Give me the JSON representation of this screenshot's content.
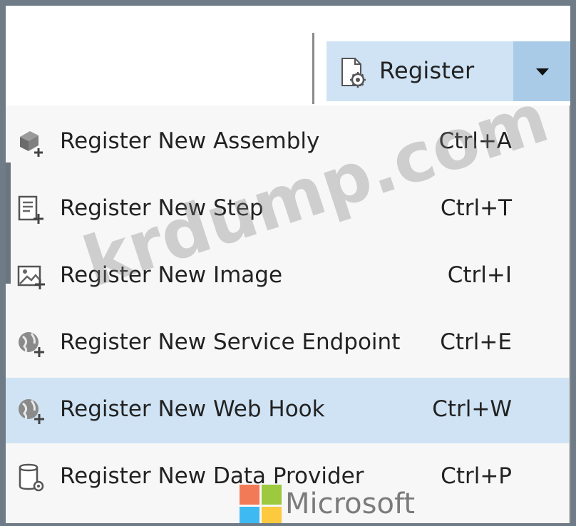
{
  "toolbar": {
    "register_label": "Register",
    "register_icon": "register-plugin-icon",
    "dropdown_icon": "chevron-down-icon"
  },
  "menu": {
    "items": [
      {
        "label": "Register New Assembly",
        "shortcut": "Ctrl+A",
        "icon": "assembly-add-icon",
        "highlighted": false
      },
      {
        "label": "Register New Step",
        "shortcut": "Ctrl+T",
        "icon": "step-add-icon",
        "highlighted": false
      },
      {
        "label": "Register New Image",
        "shortcut": "Ctrl+I",
        "icon": "image-add-icon",
        "highlighted": false
      },
      {
        "label": "Register New Service Endpoint",
        "shortcut": "Ctrl+E",
        "icon": "globe-add-icon",
        "highlighted": false
      },
      {
        "label": "Register New Web Hook",
        "shortcut": "Ctrl+W",
        "icon": "globe-add-icon",
        "highlighted": true
      },
      {
        "label": "Register New Data Provider",
        "shortcut": "Ctrl+P",
        "icon": "data-provider-icon",
        "highlighted": false
      }
    ]
  },
  "watermark": "krdump.com",
  "brand": {
    "name": "Microsoft",
    "colors": [
      "#f25022",
      "#7fba00",
      "#00a4ef",
      "#ffb900"
    ]
  },
  "colors": {
    "highlight": "#cfe3f4",
    "dropdown": "#a9cbe7"
  }
}
